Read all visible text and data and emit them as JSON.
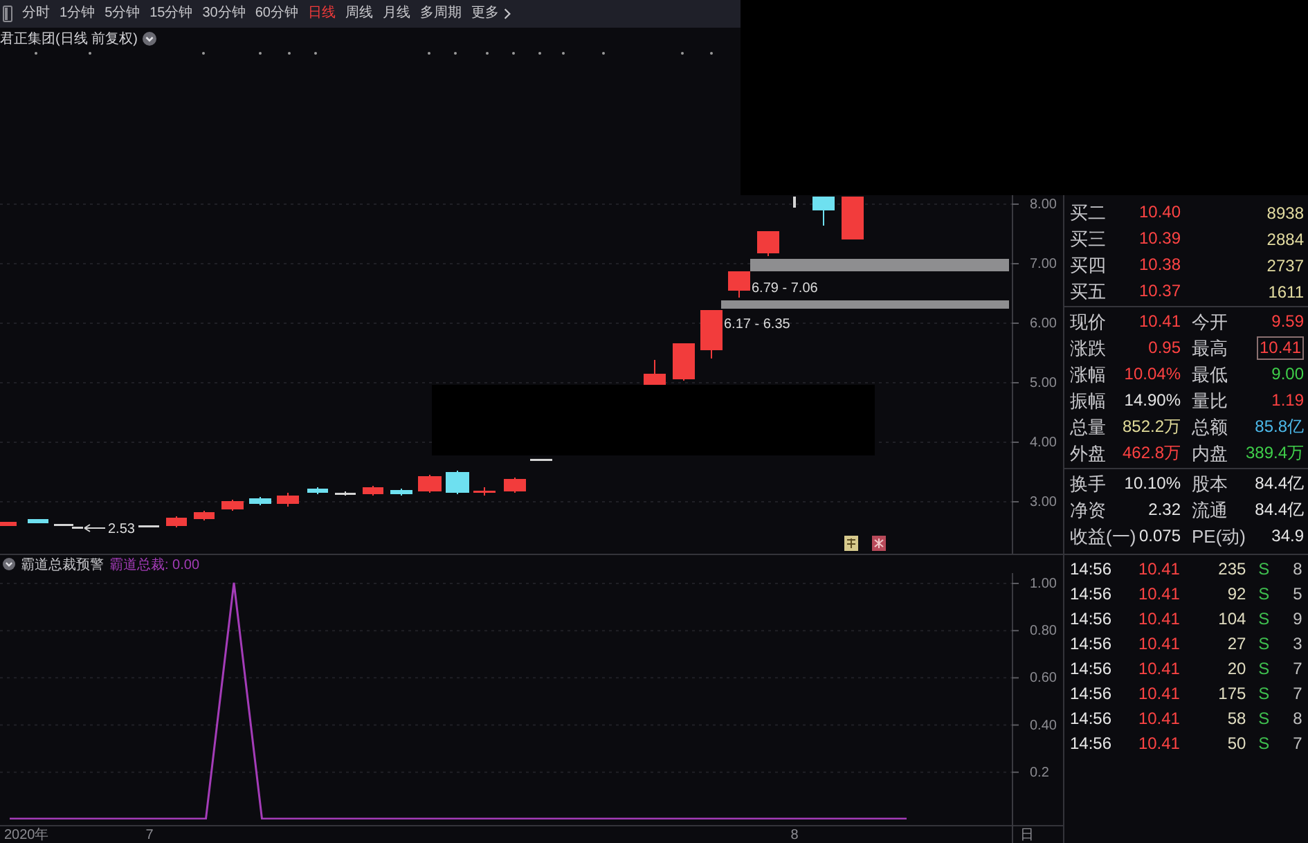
{
  "toolbar": {
    "tabs": [
      {
        "label": "分时",
        "selected": false
      },
      {
        "label": "1分钟",
        "selected": false
      },
      {
        "label": "5分钟",
        "selected": false
      },
      {
        "label": "15分钟",
        "selected": false
      },
      {
        "label": "30分钟",
        "selected": false
      },
      {
        "label": "60分钟",
        "selected": false
      },
      {
        "label": "日线",
        "selected": true
      },
      {
        "label": "周线",
        "selected": false
      },
      {
        "label": "月线",
        "selected": false
      },
      {
        "label": "多周期",
        "selected": false
      }
    ],
    "more_button": {
      "label": "更多"
    }
  },
  "price_chart": {
    "title": "君正集团(日线 前复权)",
    "price_axis": [
      "8.00",
      "7.00",
      "6.00",
      "5.00",
      "4.00",
      "3.00"
    ],
    "low_marker": "2.53",
    "price_zones": [
      {
        "label": "6.79 - 7.06"
      },
      {
        "label": "6.17 - 6.35"
      }
    ]
  },
  "indicator": {
    "title": "霸道总裁预警",
    "readout": "霸道总裁: 0.00",
    "chart_data": {
      "type": "line",
      "grid": true,
      "series": [
        {
          "color": "#a43cb8",
          "values": [
            0,
            0,
            0,
            0,
            0,
            0,
            0,
            0,
            1,
            0,
            0,
            0,
            0,
            0,
            0,
            0,
            0,
            0,
            0,
            0,
            0,
            0,
            0,
            0,
            0,
            0,
            0,
            0,
            0,
            0,
            0,
            0,
            0
          ]
        }
      ],
      "ylim": [
        -0.1,
        1
      ],
      "yticks": [
        {
          "value": 1,
          "label": "1.00"
        },
        {
          "value": 0.8,
          "label": "0.80"
        },
        {
          "value": 0.6,
          "label": "0.60"
        },
        {
          "value": 0.4,
          "label": "0.40"
        },
        {
          "value": 0.2,
          "label": "0.2"
        }
      ]
    }
  },
  "date_axis": [
    {
      "label": "2020年"
    },
    {
      "label": "7"
    },
    {
      "label": "8"
    }
  ],
  "period_label": "日",
  "order_book": {
    "bids": [
      {
        "label": "买二",
        "price": "10.40",
        "volume": "8938"
      },
      {
        "label": "买三",
        "price": "10.39",
        "volume": "2884"
      },
      {
        "label": "买四",
        "price": "10.38",
        "volume": "2737"
      },
      {
        "label": "买五",
        "price": "10.37",
        "volume": "1611"
      }
    ]
  },
  "quote": {
    "stats": [
      {
        "label": "现价",
        "value": "10.41",
        "color": "#ff4242",
        "boxed": false
      },
      {
        "label": "今开",
        "value": "9.59",
        "color": "#ff4242",
        "boxed": false
      },
      {
        "label": "涨跌",
        "value": "0.95",
        "color": "#ff4242",
        "boxed": false
      },
      {
        "label": "最高",
        "value": "10.41",
        "color": "#ff4242",
        "boxed": true
      },
      {
        "label": "涨幅",
        "value": "10.04%",
        "color": "#ff4242",
        "boxed": false
      },
      {
        "label": "最低",
        "value": "9.00",
        "color": "#3fcf4a",
        "boxed": false
      },
      {
        "label": "振幅",
        "value": "14.90%",
        "color": "#e6e6e6",
        "boxed": false
      },
      {
        "label": "量比",
        "value": "1.19",
        "color": "#ff4242",
        "boxed": false
      },
      {
        "label": "总量",
        "value": "852.2万",
        "color": "#e2dc9a",
        "boxed": false
      },
      {
        "label": "总额",
        "value": "85.8亿",
        "color": "#4cb8e8",
        "boxed": false
      },
      {
        "label": "外盘",
        "value": "462.8万",
        "color": "#ff4242",
        "boxed": false
      },
      {
        "label": "内盘",
        "value": "389.4万",
        "color": "#3fcf4a",
        "boxed": false
      }
    ],
    "fundamentals": [
      {
        "label": "换手",
        "value": "10.10%"
      },
      {
        "label": "股本",
        "value": "84.4亿"
      },
      {
        "label": "净资",
        "value": "2.32"
      },
      {
        "label": "流通",
        "value": "84.4亿"
      },
      {
        "label": "收益(一)",
        "value": "0.075"
      },
      {
        "label": "PE(动)",
        "value": "34.9"
      }
    ]
  },
  "trades": [
    {
      "time": "14:56",
      "price": "10.41",
      "volume": "235",
      "side": "S",
      "column_5": "8"
    },
    {
      "time": "14:56",
      "price": "10.41",
      "volume": "92",
      "side": "S",
      "column_5": "5"
    },
    {
      "time": "14:56",
      "price": "10.41",
      "volume": "104",
      "side": "S",
      "column_5": "9"
    },
    {
      "time": "14:56",
      "price": "10.41",
      "volume": "27",
      "side": "S",
      "column_5": "3"
    },
    {
      "time": "14:56",
      "price": "10.41",
      "volume": "20",
      "side": "S",
      "column_5": "7"
    },
    {
      "time": "14:56",
      "price": "10.41",
      "volume": "175",
      "side": "S",
      "column_5": "7"
    },
    {
      "time": "14:56",
      "price": "10.41",
      "volume": "58",
      "side": "S",
      "column_5": "8"
    },
    {
      "time": "14:56",
      "price": "10.41",
      "volume": "50",
      "side": "S",
      "column_5": "7"
    }
  ]
}
